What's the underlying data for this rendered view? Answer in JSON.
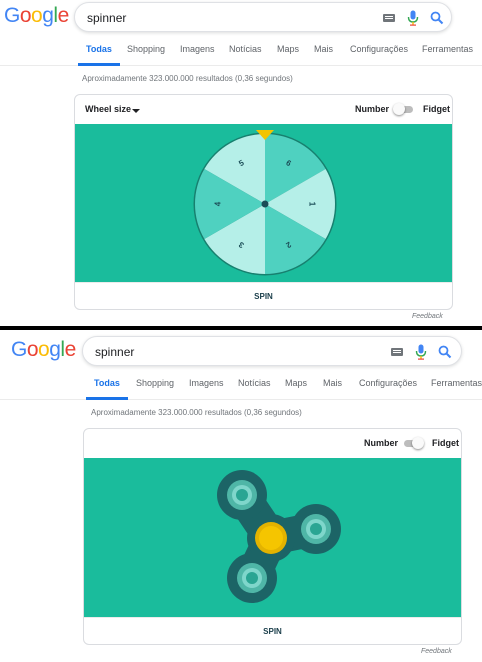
{
  "logo": {
    "letters": [
      "G",
      "o",
      "o",
      "g",
      "l",
      "e"
    ]
  },
  "search": {
    "query": "spinner"
  },
  "tabs": [
    {
      "label": "Todas"
    },
    {
      "label": "Shopping"
    },
    {
      "label": "Imagens"
    },
    {
      "label": "Notícias"
    },
    {
      "label": "Maps"
    },
    {
      "label": "Mais"
    },
    {
      "label": "Configurações"
    },
    {
      "label": "Ferramentas"
    }
  ],
  "stats": "Aproximadamente 323.000.000 resultados (0,36 segundos)",
  "widget": {
    "wheel_size_label": "Wheel size",
    "toggle_left_label": "Number",
    "toggle_right_label": "Fidget",
    "spin_label": "SPIN",
    "wheel_numbers": [
      "5",
      "6",
      "1",
      "2",
      "3",
      "4"
    ],
    "mode_top": "Number",
    "mode_bottom": "Fidget"
  },
  "feedback": "Feedback",
  "colors": {
    "stage_bg": "#1abc9c",
    "wheel_dark": "#4fd1c0",
    "wheel_light": "#b5efe8",
    "pointer": "#f3c400",
    "fidget_body": "#1c6466",
    "fidget_center": "#f5c500"
  },
  "icons": [
    "keyboard-icon",
    "microphone-icon",
    "search-icon",
    "dropdown-caret-icon"
  ]
}
